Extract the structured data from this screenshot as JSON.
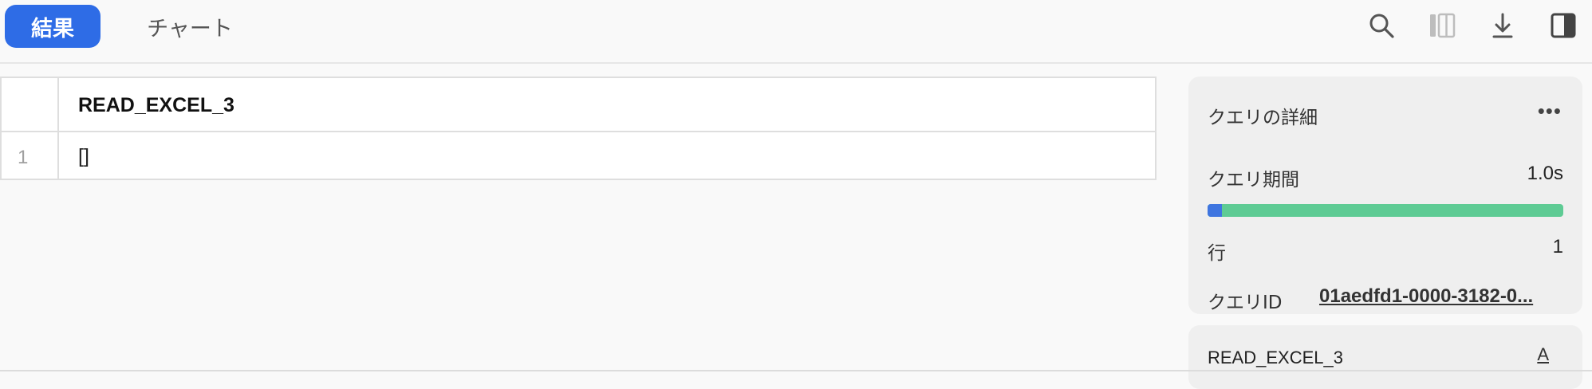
{
  "tabs": [
    {
      "label": "結果",
      "active": true
    },
    {
      "label": "チャート",
      "active": false
    }
  ],
  "toolbar": {
    "icons": [
      "search-icon",
      "columns-icon",
      "download-icon",
      "split-panel-icon"
    ]
  },
  "grid": {
    "columns": [
      "READ_EXCEL_3"
    ],
    "rows": [
      {
        "num": "1",
        "cells": [
          "[]"
        ]
      }
    ]
  },
  "query_details": {
    "title": "クエリの詳細",
    "more_label": "•••",
    "duration_label": "クエリ期間",
    "duration_value": "1.0s",
    "duration_compile_fraction": 0.04,
    "rows_label": "行",
    "rows_value": "1",
    "query_id_label": "クエリID",
    "query_id_value": "01aedfd1-0000-3182-0..."
  },
  "column_panel": {
    "name": "READ_EXCEL_3",
    "type_label": "A"
  },
  "colors": {
    "accent": "#2e6ce6",
    "bar_main": "#5ecb94",
    "bar_segment": "#3f75e0"
  }
}
